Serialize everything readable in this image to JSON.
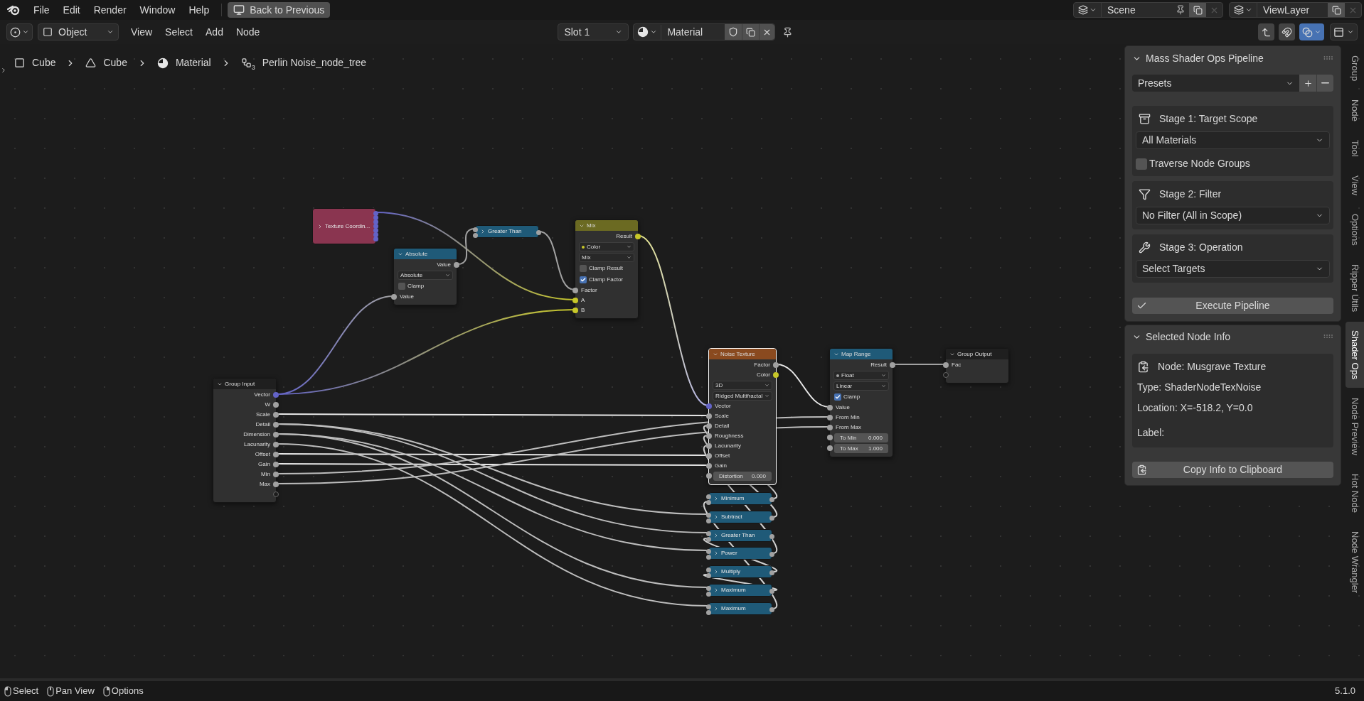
{
  "menu": [
    "File",
    "Edit",
    "Render",
    "Window",
    "Help"
  ],
  "back_button": "Back to Previous",
  "header": {
    "mode": "Object",
    "menus": [
      "View",
      "Select",
      "Add",
      "Node"
    ],
    "slot": "Slot 1",
    "material": "Material"
  },
  "scene": "Scene",
  "view_layer": "ViewLayer",
  "toggles": [
    {
      "on": false
    },
    {
      "on": false
    },
    {
      "on": true
    }
  ],
  "breadcrumb": [
    {
      "kind": "object",
      "label": "Cube"
    },
    {
      "kind": "mesh",
      "label": "Cube"
    },
    {
      "kind": "material",
      "label": "Material"
    },
    {
      "kind": "node_tree",
      "label": "Perlin Noise_node_tree",
      "users": "3"
    }
  ],
  "nodes": [
    {
      "title": "Texture Coordin...",
      "color": "#8a3550",
      "expanded": false,
      "selected": false
    },
    {
      "title": "Absolute",
      "color": "#1f5a78",
      "expanded": true,
      "selected": false,
      "rows": [
        {
          "kind": "output",
          "label": "Value",
          "color": "#a1a1a1"
        },
        {
          "kind": "dropdown",
          "label": "Absolute"
        },
        {
          "kind": "checkbox",
          "label": "Clamp",
          "checked": false
        },
        {
          "kind": "input",
          "label": "Value",
          "color": "#a1a1a1"
        }
      ]
    },
    {
      "title": "Greater Than",
      "color": "#1f5a78",
      "expanded": false,
      "selected": false
    },
    {
      "title": "Mix",
      "color": "#6b6a22",
      "expanded": true,
      "selected": false,
      "rows": [
        {
          "kind": "output",
          "label": "Result",
          "color": "#c7c729"
        },
        {
          "kind": "dropdown",
          "label": "Color",
          "color": "#c7c729"
        },
        {
          "kind": "dropdown",
          "label": "Mix"
        },
        {
          "kind": "checkbox",
          "label": "Clamp Result",
          "checked": false
        },
        {
          "kind": "checkbox",
          "label": "Clamp Factor",
          "checked": true
        },
        {
          "kind": "input",
          "label": "Factor",
          "color": "#a1a1a1"
        },
        {
          "kind": "input",
          "label": "A",
          "color": "#c7c729"
        },
        {
          "kind": "input",
          "label": "B",
          "color": "#c7c729"
        }
      ]
    },
    {
      "title": "Group Input",
      "color": "#1f1f1f",
      "expanded": true,
      "selected": false,
      "rows": [
        {
          "kind": "output",
          "label": "Vector",
          "color": "#6363c7"
        },
        {
          "kind": "output",
          "label": "W",
          "color": "#a1a1a1"
        },
        {
          "kind": "output",
          "label": "Scale",
          "color": "#a1a1a1"
        },
        {
          "kind": "output",
          "label": "Detail",
          "color": "#a1a1a1"
        },
        {
          "kind": "output",
          "label": "Dimension",
          "color": "#a1a1a1"
        },
        {
          "kind": "output",
          "label": "Lacunarity",
          "color": "#a1a1a1"
        },
        {
          "kind": "output",
          "label": "Offset",
          "color": "#a1a1a1"
        },
        {
          "kind": "output",
          "label": "Gain",
          "color": "#a1a1a1"
        },
        {
          "kind": "output",
          "label": "Min",
          "color": "#a1a1a1"
        },
        {
          "kind": "output",
          "label": "Max",
          "color": "#a1a1a1"
        },
        {
          "kind": "output"
        }
      ]
    },
    {
      "title": "Noise Texture",
      "color": "#8a4a1f",
      "expanded": true,
      "selected": true,
      "rows": [
        {
          "kind": "output",
          "label": "Factor",
          "color": "#a1a1a1"
        },
        {
          "kind": "output",
          "label": "Color",
          "color": "#c7c729"
        },
        {
          "kind": "dropdown",
          "label": "3D"
        },
        {
          "kind": "dropdown",
          "label": "Ridged Multifractal"
        },
        {
          "kind": "input",
          "label": "Vector",
          "color": "#6363c7"
        },
        {
          "kind": "input",
          "label": "Scale",
          "color": "#a1a1a1"
        },
        {
          "kind": "input",
          "label": "Detail",
          "color": "#a1a1a1"
        },
        {
          "kind": "input",
          "label": "Roughness",
          "color": "#a1a1a1"
        },
        {
          "kind": "input",
          "label": "Lacunarity",
          "color": "#a1a1a1"
        },
        {
          "kind": "input",
          "label": "Offset",
          "color": "#a1a1a1"
        },
        {
          "kind": "input",
          "label": "Gain",
          "color": "#a1a1a1"
        },
        {
          "kind": "field",
          "label": "Distortion",
          "value": "0.000",
          "color": "#a1a1a1"
        }
      ]
    },
    {
      "title": "Map Range",
      "color": "#1f5a78",
      "expanded": true,
      "selected": false,
      "rows": [
        {
          "kind": "output",
          "label": "Result",
          "color": "#a1a1a1"
        },
        {
          "kind": "dropdown",
          "label": "Float",
          "color": "#a1a1a1"
        },
        {
          "kind": "dropdown",
          "label": "Linear"
        },
        {
          "kind": "checkbox",
          "label": "Clamp",
          "checked": true
        },
        {
          "kind": "input",
          "label": "Value",
          "color": "#a1a1a1"
        },
        {
          "kind": "input",
          "label": "From Min",
          "color": "#a1a1a1"
        },
        {
          "kind": "input",
          "label": "From Max",
          "color": "#a1a1a1"
        },
        {
          "kind": "field",
          "label": "To Min",
          "value": "0.000",
          "color": "#a1a1a1"
        },
        {
          "kind": "field",
          "label": "To Max",
          "value": "1.000",
          "color": "#a1a1a1"
        }
      ]
    },
    {
      "title": "Group Output",
      "color": "#1f1f1f",
      "expanded": true,
      "selected": false,
      "rows": [
        {
          "kind": "input",
          "label": "Fac",
          "color": "#a1a1a1"
        },
        {
          "kind": "input"
        }
      ]
    },
    {
      "title": "Minimum",
      "color": "#1f5a78",
      "expanded": false,
      "selected": false
    },
    {
      "title": "Subtract",
      "color": "#1f5a78",
      "expanded": false,
      "selected": false
    },
    {
      "title": "Greater Than",
      "color": "#1f5a78",
      "expanded": false,
      "selected": false
    },
    {
      "title": "Power",
      "color": "#1f5a78",
      "expanded": false,
      "selected": false
    },
    {
      "title": "Multiply",
      "color": "#1f5a78",
      "expanded": false,
      "selected": false
    },
    {
      "title": "Maximum",
      "color": "#1f5a78",
      "expanded": false,
      "selected": false
    },
    {
      "title": "Maximum",
      "color": "#1f5a78",
      "expanded": false,
      "selected": false
    }
  ],
  "sidebar": {
    "pipeline": {
      "title": "Mass Shader Ops Pipeline",
      "expanded": true,
      "presets": "Presets",
      "stages": [
        {
          "kind": "scope",
          "title": "Stage 1: Target Scope",
          "dropdown": "All Materials",
          "checkbox": {
            "label": "Traverse Node Groups",
            "checked": false
          }
        },
        {
          "kind": "filter",
          "title": "Stage 2: Filter",
          "dropdown": "No Filter (All in Scope)"
        },
        {
          "kind": "operation",
          "title": "Stage 3: Operation",
          "dropdown": "Select Targets"
        }
      ],
      "button": "Execute Pipeline"
    },
    "info": {
      "title": "Selected Node Info",
      "expanded": true,
      "node": "Node: Musgrave Texture",
      "lines": [
        "Type: ShaderNodeTexNoise",
        "Location: X=-518.2, Y=0.0",
        "Label:"
      ],
      "button": "Copy Info to Clipboard"
    }
  },
  "tabs": [
    {
      "label": "Group",
      "selected": false
    },
    {
      "label": "Node",
      "selected": false
    },
    {
      "label": "Tool",
      "selected": false
    },
    {
      "label": "View",
      "selected": false
    },
    {
      "label": "Options",
      "selected": false
    },
    {
      "label": "Ripper Utils",
      "selected": false
    },
    {
      "label": "Shader Ops",
      "selected": true
    },
    {
      "label": "Node Preview",
      "selected": false
    },
    {
      "label": "Hot Node",
      "selected": false
    },
    {
      "label": "Node Wrangler",
      "selected": false
    }
  ],
  "status_bar": {
    "items": [
      {
        "kind": "left",
        "label": "Select"
      },
      {
        "kind": "middle",
        "label": "Pan View"
      },
      {
        "kind": "right",
        "label": "Options"
      }
    ],
    "version": "5.1.0"
  }
}
